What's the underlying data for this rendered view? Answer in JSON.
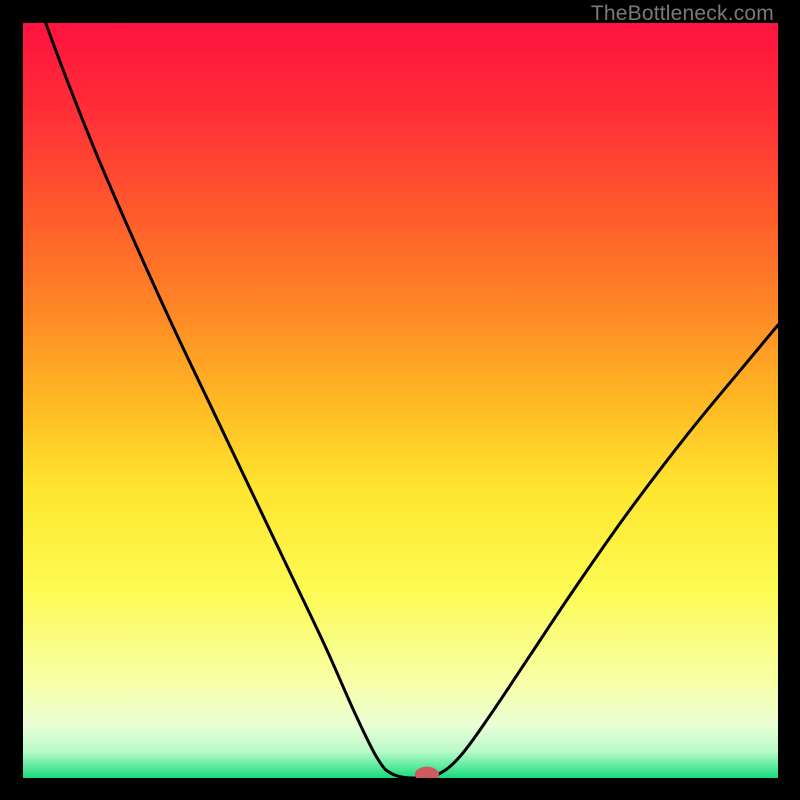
{
  "watermark": "TheBottleneck.com",
  "chart_data": {
    "type": "line",
    "title": "",
    "xlabel": "",
    "ylabel": "",
    "xlim": [
      0,
      100
    ],
    "ylim": [
      0,
      100
    ],
    "grid": false,
    "legend": false,
    "background_gradient": [
      {
        "offset": 0.0,
        "color": "#ff123f"
      },
      {
        "offset": 0.12,
        "color": "#ff2f37"
      },
      {
        "offset": 0.25,
        "color": "#ff5a2c"
      },
      {
        "offset": 0.38,
        "color": "#ff8726"
      },
      {
        "offset": 0.5,
        "color": "#ffb823"
      },
      {
        "offset": 0.62,
        "color": "#ffe630"
      },
      {
        "offset": 0.75,
        "color": "#fdfb53"
      },
      {
        "offset": 0.87,
        "color": "#f8ffa5"
      },
      {
        "offset": 0.93,
        "color": "#eaffd6"
      },
      {
        "offset": 0.965,
        "color": "#b9f9ca"
      },
      {
        "offset": 0.985,
        "color": "#5beb9d"
      },
      {
        "offset": 1.0,
        "color": "#18d979"
      }
    ],
    "series": [
      {
        "name": "bottleneck-curve",
        "stroke": "#000000",
        "stroke_width": 3,
        "points": [
          {
            "x": 3.0,
            "y": 100.0
          },
          {
            "x": 6.0,
            "y": 92.0
          },
          {
            "x": 10.0,
            "y": 82.0
          },
          {
            "x": 15.0,
            "y": 70.5
          },
          {
            "x": 20.0,
            "y": 59.5
          },
          {
            "x": 25.0,
            "y": 49.0
          },
          {
            "x": 30.0,
            "y": 38.5
          },
          {
            "x": 35.0,
            "y": 28.0
          },
          {
            "x": 40.0,
            "y": 17.5
          },
          {
            "x": 44.0,
            "y": 8.5
          },
          {
            "x": 47.0,
            "y": 2.5
          },
          {
            "x": 49.0,
            "y": 0.5
          },
          {
            "x": 52.0,
            "y": 0.0
          },
          {
            "x": 55.0,
            "y": 0.5
          },
          {
            "x": 58.0,
            "y": 3.0
          },
          {
            "x": 62.0,
            "y": 8.5
          },
          {
            "x": 67.0,
            "y": 16.0
          },
          {
            "x": 73.0,
            "y": 25.0
          },
          {
            "x": 80.0,
            "y": 35.0
          },
          {
            "x": 88.0,
            "y": 45.5
          },
          {
            "x": 95.0,
            "y": 54.0
          },
          {
            "x": 100.0,
            "y": 60.0
          }
        ]
      }
    ],
    "marker": {
      "x": 53.5,
      "y": 0.5,
      "rx": 1.6,
      "ry": 1.0,
      "fill": "#cf5960"
    }
  }
}
